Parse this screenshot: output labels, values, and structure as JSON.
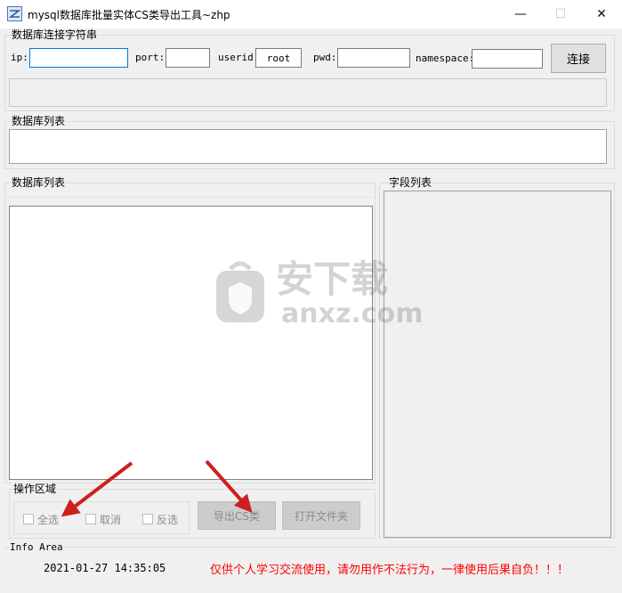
{
  "window": {
    "title": "mysql数据库批量实体CS类导出工具~zhp",
    "controls": {
      "minimize": "—",
      "maximize": "☐",
      "close": "✕"
    }
  },
  "connection_group": {
    "title": "数据库连接字符串",
    "ip_label": "ip:",
    "ip_value": "",
    "port_label": "port:",
    "port_value": "",
    "userid_label": "userid:",
    "userid_value": "root",
    "pwd_label": "pwd:",
    "pwd_value": "",
    "namespace_label": "namespace:",
    "namespace_value": "",
    "connect_button": "连接"
  },
  "db_list_top": {
    "title": "数据库列表"
  },
  "db_list_left": {
    "title": "数据库列表"
  },
  "field_list": {
    "title": "字段列表"
  },
  "operation": {
    "title": "操作区域",
    "select_all": "全选",
    "cancel": "取消",
    "invert": "反选",
    "export_button": "导出CS类",
    "open_folder_button": "打开文件夹"
  },
  "info": {
    "title": "Info Area",
    "timestamp": "2021-01-27 14:35:05",
    "notice": "仅供个人学习交流使用，请勿用作不法行为，一律使用后果自负！！！"
  },
  "watermark": {
    "text": "安下载",
    "url": "anxz.com"
  },
  "colors": {
    "accent": "#0078d7",
    "notice": "#ff0000",
    "arrow": "#d01f1f"
  }
}
